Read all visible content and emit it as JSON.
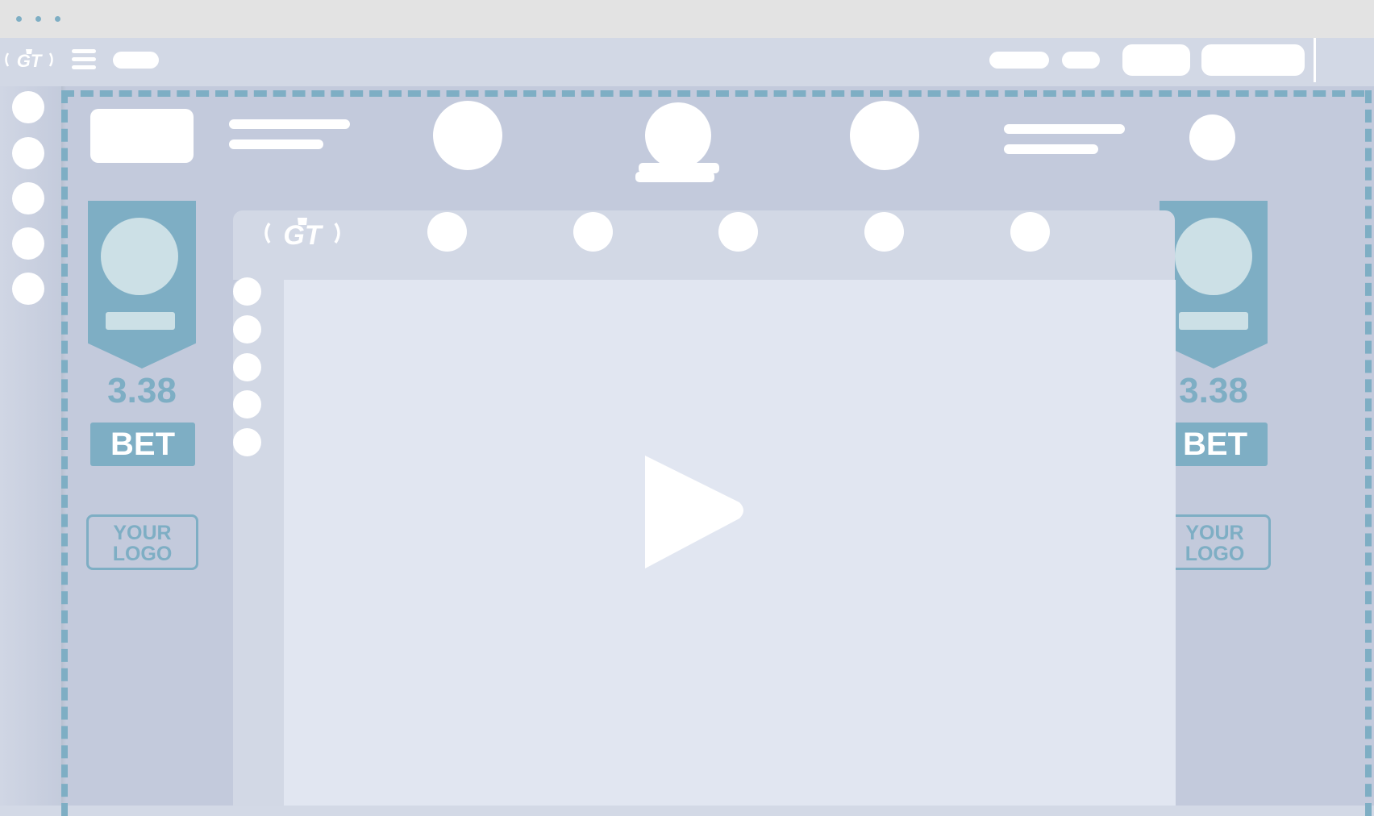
{
  "window": {
    "dots": [
      "traffic-dot-1",
      "traffic-dot-2",
      "traffic-dot-3"
    ]
  },
  "header": {
    "logo_text": "GT",
    "menu_icon": "hamburger-icon"
  },
  "left_promo": {
    "odds": "3.38",
    "bet_label": "BET",
    "logo_line1": "YOUR",
    "logo_line2": "LOGO"
  },
  "right_promo": {
    "odds": "3.38",
    "bet_label": "BET",
    "logo_line1": "YOUR",
    "logo_line2": "LOGO"
  },
  "panel": {
    "logo_text": "GT",
    "play_icon": "play-icon"
  },
  "colors": {
    "accent": "#7eaec4",
    "background": "#c3cadc",
    "panel": "#d2d8e5",
    "video": "#e1e6f1",
    "chrome": "#e3e3e3"
  }
}
